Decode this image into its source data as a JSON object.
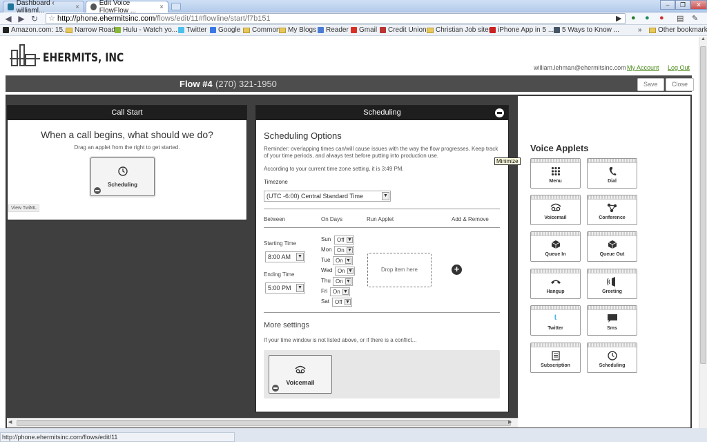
{
  "browser": {
    "tabs": [
      {
        "label": "Dashboard ‹ williaml..."
      },
      {
        "label": "Edit Voice FlowFlow ..."
      }
    ],
    "url_host": "http://phone.ehermitsinc.com",
    "url_path": "/flows/edit/11#flowline/start/f7b151",
    "bookmarks": [
      "Amazon.com: 15...",
      "Narrow Road",
      "Hulu - Watch yo...",
      "Twitter",
      "Google",
      "Common",
      "My Blogs",
      "Reader",
      "Gmail",
      "Credit Union",
      "Christian Job sites",
      "iPhone App in 5 ...",
      "5 Ways to Know ...",
      "Other bookmarks"
    ],
    "status_url": "http://phone.ehermitsinc.com/flows/edit/11"
  },
  "header": {
    "logo_text": "EHERMITS, INC",
    "user_email": "william.lehman@ehermitsinc.com",
    "my_account": "My Account",
    "log_out": "Log Out"
  },
  "flowbar": {
    "title": "Flow #4",
    "phone": "(270) 321-1950",
    "save": "Save",
    "close": "Close"
  },
  "call_start": {
    "header": "Call Start",
    "question": "When a call begins, what should we do?",
    "hint": "Drag an applet from the right to get started.",
    "applet_label": "Scheduling",
    "view_twiml": "View TwiML"
  },
  "scheduling": {
    "header": "Scheduling",
    "minimize_tooltip": "Minimize",
    "title": "Scheduling Options",
    "reminder": "Reminder: overlapping times can/will cause issues with the way the flow progresses. Keep track of your time periods, and always test before putting into production use.",
    "current_time_note": "According to your current time zone setting, it is 3:49 PM.",
    "timezone_label": "Timezone",
    "timezone_value": "(UTC -6:00) Central Standard Time",
    "columns": [
      "Between",
      "On Days",
      "Run Applet",
      "Add & Remove"
    ],
    "starting_time_label": "Starting Time",
    "starting_time": "8:00 AM",
    "ending_time_label": "Ending Time",
    "ending_time": "5:00 PM",
    "days": [
      {
        "day": "Sun",
        "value": "Off"
      },
      {
        "day": "Mon",
        "value": "On"
      },
      {
        "day": "Tue",
        "value": "On"
      },
      {
        "day": "Wed",
        "value": "On"
      },
      {
        "day": "Thu",
        "value": "On"
      },
      {
        "day": "Fri",
        "value": "On"
      },
      {
        "day": "Sat",
        "value": "Off"
      }
    ],
    "drop_zone": "Drop item here",
    "more_settings": "More settings",
    "fallback_note": "If your time window is not listed above, or if there is a conflict...",
    "fallback_applet": "Voicemail"
  },
  "applets": {
    "title": "Voice Applets",
    "items": [
      {
        "label": "Menu",
        "icon": "grid-icon"
      },
      {
        "label": "Dial",
        "icon": "phone-icon"
      },
      {
        "label": "Voicemail",
        "icon": "voicemail-icon"
      },
      {
        "label": "Conference",
        "icon": "conference-icon"
      },
      {
        "label": "Queue In",
        "icon": "box-icon"
      },
      {
        "label": "Queue Out",
        "icon": "box-icon"
      },
      {
        "label": "Hangup",
        "icon": "hangup-icon"
      },
      {
        "label": "Greeting",
        "icon": "speaker-icon"
      },
      {
        "label": "Twitter",
        "icon": "twitter-icon"
      },
      {
        "label": "Sms",
        "icon": "sms-icon"
      },
      {
        "label": "Subscription",
        "icon": "list-icon"
      },
      {
        "label": "Scheduling",
        "icon": "clock-icon"
      }
    ]
  },
  "colors": {
    "accent_link": "#4b8b1a",
    "dark_bar": "#4d4d4d",
    "canvas": "#3f3f3f"
  }
}
